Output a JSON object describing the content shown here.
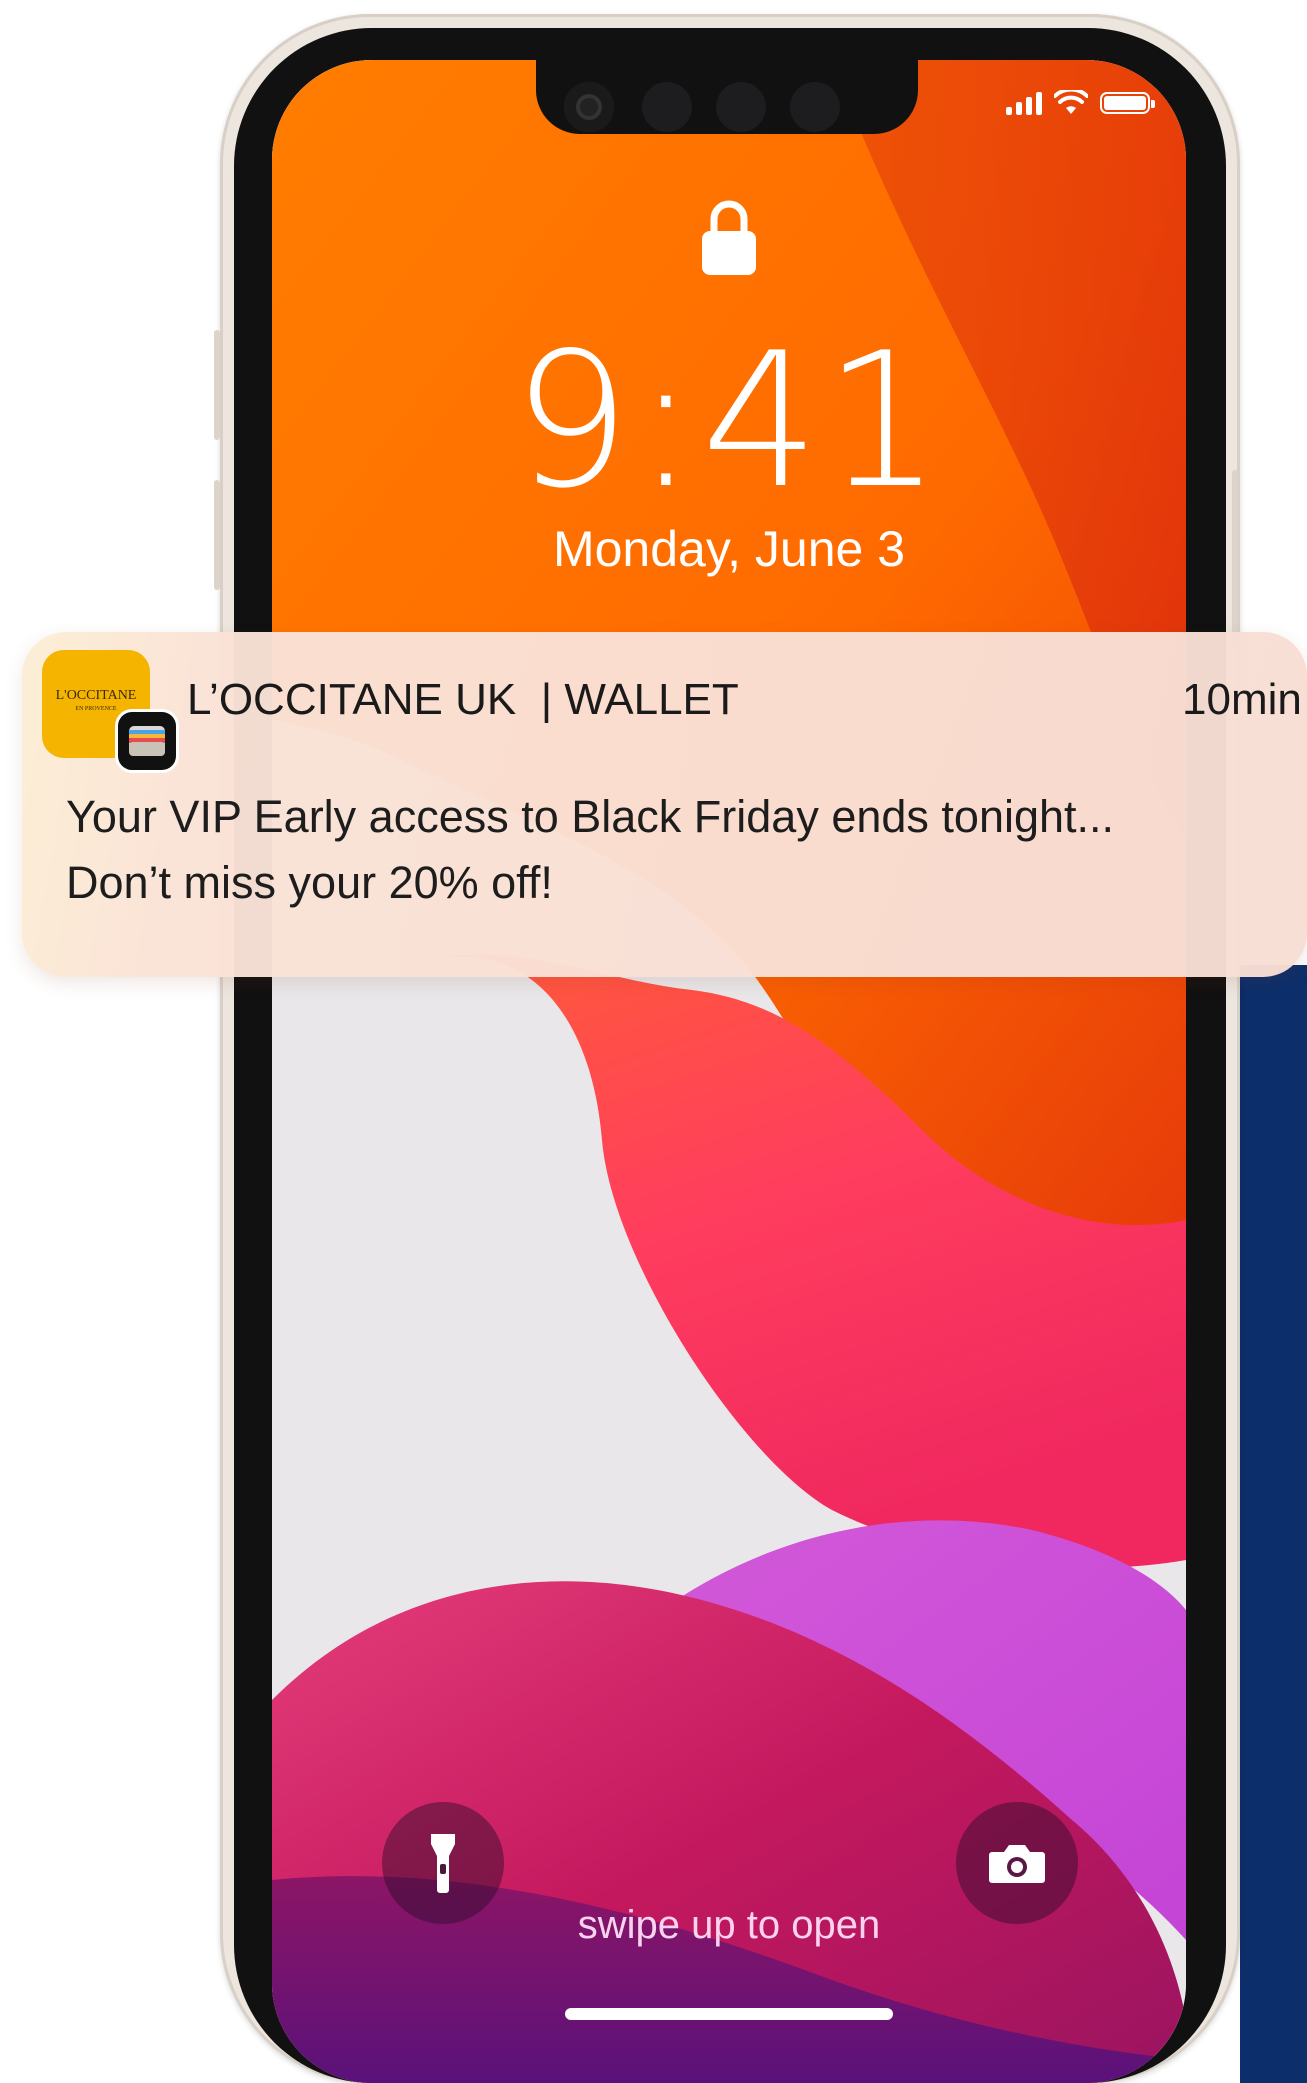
{
  "status_bar": {
    "icons": [
      "cellular-signal-icon",
      "wifi-icon",
      "battery-icon"
    ]
  },
  "lock_screen": {
    "lock_icon": "lock-icon",
    "time": "9:41",
    "date": "Monday, June 3",
    "flashlight_icon": "flashlight-icon",
    "camera_icon": "camera-icon",
    "swipe_hint": "swipe up to open"
  },
  "notification": {
    "app_icon_text": "L'OCCITANE",
    "app_icon_subtext": "EN PROVENCE",
    "badge_icon": "wallet-icon",
    "app_name": "L’OCCITANE UK  | WALLET",
    "time": "10min",
    "body_line1": "Your VIP Early access to Black Friday ends tonight...",
    "body_line2": "Don’t miss your 20% off!"
  },
  "colors": {
    "wallpaper_orange": "#ff6a00",
    "wallpaper_pink": "#ff3366",
    "wallpaper_purple": "#c72fd1",
    "notification_bg": "#f9dfd4",
    "side_strip": "#0c2f6b",
    "icon_yellow": "#f4b400"
  }
}
